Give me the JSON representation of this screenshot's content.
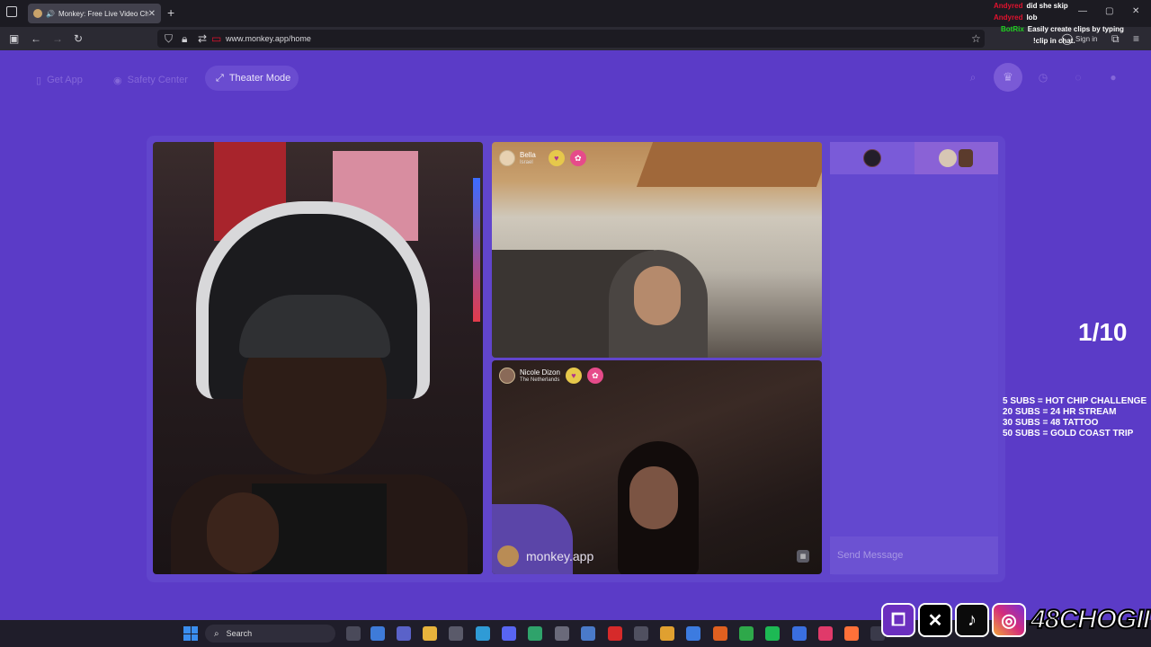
{
  "browser": {
    "tab_title": "Monkey: Free Live Video Ch",
    "url": "www.monkey.app/home",
    "sign_in": "Sign in"
  },
  "stream_chat": [
    {
      "user": "Andyred",
      "message": "did she skip"
    },
    {
      "user": "Andyred",
      "message": "lob"
    },
    {
      "user": "BotRix",
      "message": "Easily create clips by typing"
    },
    {
      "user": "",
      "message": "!clip in chat."
    }
  ],
  "app_nav": {
    "get_app": "Get App",
    "safety_center": "Safety Center",
    "theater_mode": "Theater Mode"
  },
  "participants": [
    {
      "name": "Bella",
      "country": "Israel"
    },
    {
      "name": "Nicole Dizon",
      "country": "The Netherlands"
    }
  ],
  "watermark": "monkey.app",
  "chat_panel": {
    "send_placeholder": "Send Message"
  },
  "overlay": {
    "counter": "1/10",
    "sub_goals": [
      "5 SUBS = HOT CHIP CHALLENGE",
      "20 SUBS = 24 HR STREAM",
      "30 SUBS = 48 TATTOO",
      "50 SUBS = GOLD COAST TRIP"
    ],
    "handle": "48CHOGII"
  },
  "taskbar": {
    "search": "Search"
  },
  "colors": {
    "page_bg": "#5b3bc7",
    "panel_bg": "#6348cf",
    "username_red": "#e1122e",
    "username_green": "#1fd21f"
  }
}
